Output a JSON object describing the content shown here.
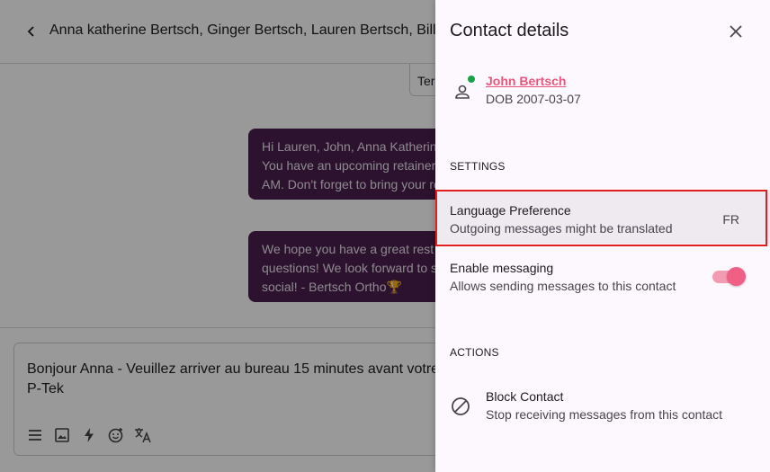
{
  "conversation": {
    "title": "Anna katherine Bertsch, Ginger Bertsch, Lauren Bertsch, Bill",
    "template_chip": "Ter",
    "messages": [
      {
        "lines": [
          "Hi Lauren, John, Anna Katherin",
          "You have an upcoming retainer",
          "AM. Don't forget to bring your re"
        ]
      },
      {
        "lines": [
          "We hope you have a great rest",
          "questions! We look forward to s",
          "social! - Bertsch Ortho🏆"
        ]
      }
    ],
    "composer": {
      "lines": [
        "Bonjour Anna - Veuillez arriver au bureau 15 minutes avant votre",
        "P-Tek"
      ]
    }
  },
  "panel": {
    "title": "Contact details",
    "contact": {
      "name": "John Bertsch",
      "dob": "DOB 2007-03-07",
      "online_color": "#17a34a"
    },
    "settings_label": "SETTINGS",
    "language": {
      "title": "Language Preference",
      "subtitle": "Outgoing messages might be translated",
      "value": "FR"
    },
    "messaging": {
      "title": "Enable messaging",
      "subtitle": "Allows sending messages to this contact",
      "enabled": true
    },
    "actions_label": "ACTIONS",
    "block": {
      "title": "Block Contact",
      "subtitle": "Stop receiving messages from this contact"
    }
  },
  "colors": {
    "accent": "#e8577c",
    "bubble": "#4a1f4d",
    "highlight": "#e02020"
  }
}
